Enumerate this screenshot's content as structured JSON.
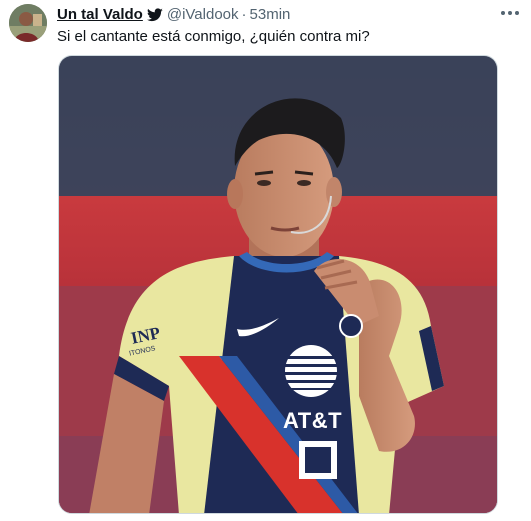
{
  "tweet": {
    "display_name": "Un tal Valdo",
    "handle": "@iValdook",
    "separator": "·",
    "time": "53min",
    "text": "Si el cantante está conmigo, ¿quién contra mi?"
  },
  "icons": {
    "avatar": "user-avatar",
    "verified": "twitter-bird-icon",
    "more": "more-options-icon"
  },
  "media": {
    "jersey_sponsor": "AT&T",
    "jersey_brand_left": "INP",
    "jersey_brand_left_sub": "ITONOS"
  },
  "colors": {
    "text": "#0f1419",
    "muted": "#536471",
    "brand_blue": "#1d9bf0",
    "jersey_yellow": "#e9e7a0",
    "jersey_navy": "#1e2a55",
    "jersey_red": "#d8322c"
  }
}
